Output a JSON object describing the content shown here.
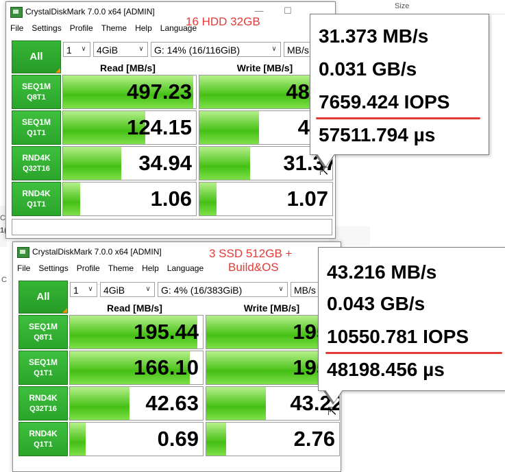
{
  "background": {
    "right_column_label": "Size",
    "faint_texts": [
      "Ca",
      "1(",
      "C"
    ]
  },
  "windows": [
    {
      "title": "CrystalDiskMark 7.0.0 x64 [ADMIN]",
      "annotation": "16 HDD 32GB",
      "menu": [
        "File",
        "Settings",
        "Profile",
        "Theme",
        "Help",
        "Language"
      ],
      "all_label": "All",
      "count": "1",
      "size": "4GiB",
      "drive": "G: 14% (16/116GiB)",
      "unit": "MB/s",
      "read_header": "Read [MB/s]",
      "write_header": "Write [MB/s]",
      "tests": [
        {
          "name": "SEQ1M",
          "params": "Q8T1",
          "read": "497.23",
          "write": "489.0",
          "read_fill": 0.98,
          "write_fill": 0.97
        },
        {
          "name": "SEQ1M",
          "params": "Q1T1",
          "read": "124.15",
          "write": "40.6",
          "read_fill": 0.62,
          "write_fill": 0.45
        },
        {
          "name": "RND4K",
          "params": "Q32T16",
          "read": "34.94",
          "write": "31.37",
          "read_fill": 0.44,
          "write_fill": 0.38
        },
        {
          "name": "RND4K",
          "params": "Q1T1",
          "read": "1.06",
          "write": "1.07",
          "read_fill": 0.13,
          "write_fill": 0.13
        }
      ],
      "tooltip": {
        "lines": [
          "31.373 MB/s",
          "0.031 GB/s",
          "7659.424 IOPS",
          "57511.794 µs"
        ]
      }
    },
    {
      "title": "CrystalDiskMark 7.0.0 x64 [ADMIN]",
      "annotation_line1": "3 SSD 512GB +",
      "annotation_line2": "Build&OS",
      "menu": [
        "File",
        "Settings",
        "Profile",
        "Theme",
        "Help",
        "Language"
      ],
      "all_label": "All",
      "count": "1",
      "size": "4GiB",
      "drive": "G: 4% (16/383GiB)",
      "unit": "MB/s",
      "read_header": "Read [MB/s]",
      "write_header": "Write [MB/s]",
      "tests": [
        {
          "name": "SEQ1M",
          "params": "Q8T1",
          "read": "195.44",
          "write": "195.0",
          "read_fill": 0.96,
          "write_fill": 0.96
        },
        {
          "name": "SEQ1M",
          "params": "Q1T1",
          "read": "166.10",
          "write": "195.0",
          "read_fill": 0.9,
          "write_fill": 0.96
        },
        {
          "name": "RND4K",
          "params": "Q32T16",
          "read": "42.63",
          "write": "43.22",
          "read_fill": 0.45,
          "write_fill": 0.45
        },
        {
          "name": "RND4K",
          "params": "Q1T1",
          "read": "0.69",
          "write": "2.76",
          "read_fill": 0.12,
          "write_fill": 0.15
        }
      ],
      "tooltip": {
        "lines": [
          "43.216 MB/s",
          "0.043 GB/s",
          "10550.781 IOPS",
          "48198.456 µs"
        ]
      }
    }
  ],
  "colors": {
    "annotation_red": "#e53935",
    "button_green": "#2aa52a",
    "bar_green": "#45c015"
  }
}
